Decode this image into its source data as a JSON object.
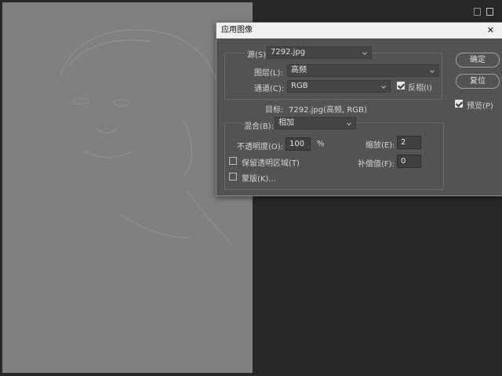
{
  "dialog": {
    "title": "应用图像",
    "source_label": "源(S):",
    "source_value": "7292.jpg",
    "layer_label": "图层(L):",
    "layer_value": "高频",
    "channel_label": "通道(C):",
    "channel_value": "RGB",
    "invert_label": "反相(I)",
    "invert_checked": true,
    "target_label": "目标:",
    "target_value": "7292.jpg(高频, RGB)",
    "blend_label": "混合(B):",
    "blend_value": "相加",
    "opacity_label": "不透明度(O):",
    "opacity_value": "100",
    "opacity_unit": "%",
    "scale_label": "缩放(E):",
    "scale_value": "2",
    "preserve_transparency_label": "保留透明区域(T)",
    "preserve_transparency_checked": false,
    "offset_label": "补偿值(F):",
    "offset_value": "0",
    "mask_label": "蒙版(K)...",
    "mask_checked": false,
    "ok_label": "确定",
    "reset_label": "复位",
    "preview_label": "预览(P)",
    "preview_checked": true
  }
}
